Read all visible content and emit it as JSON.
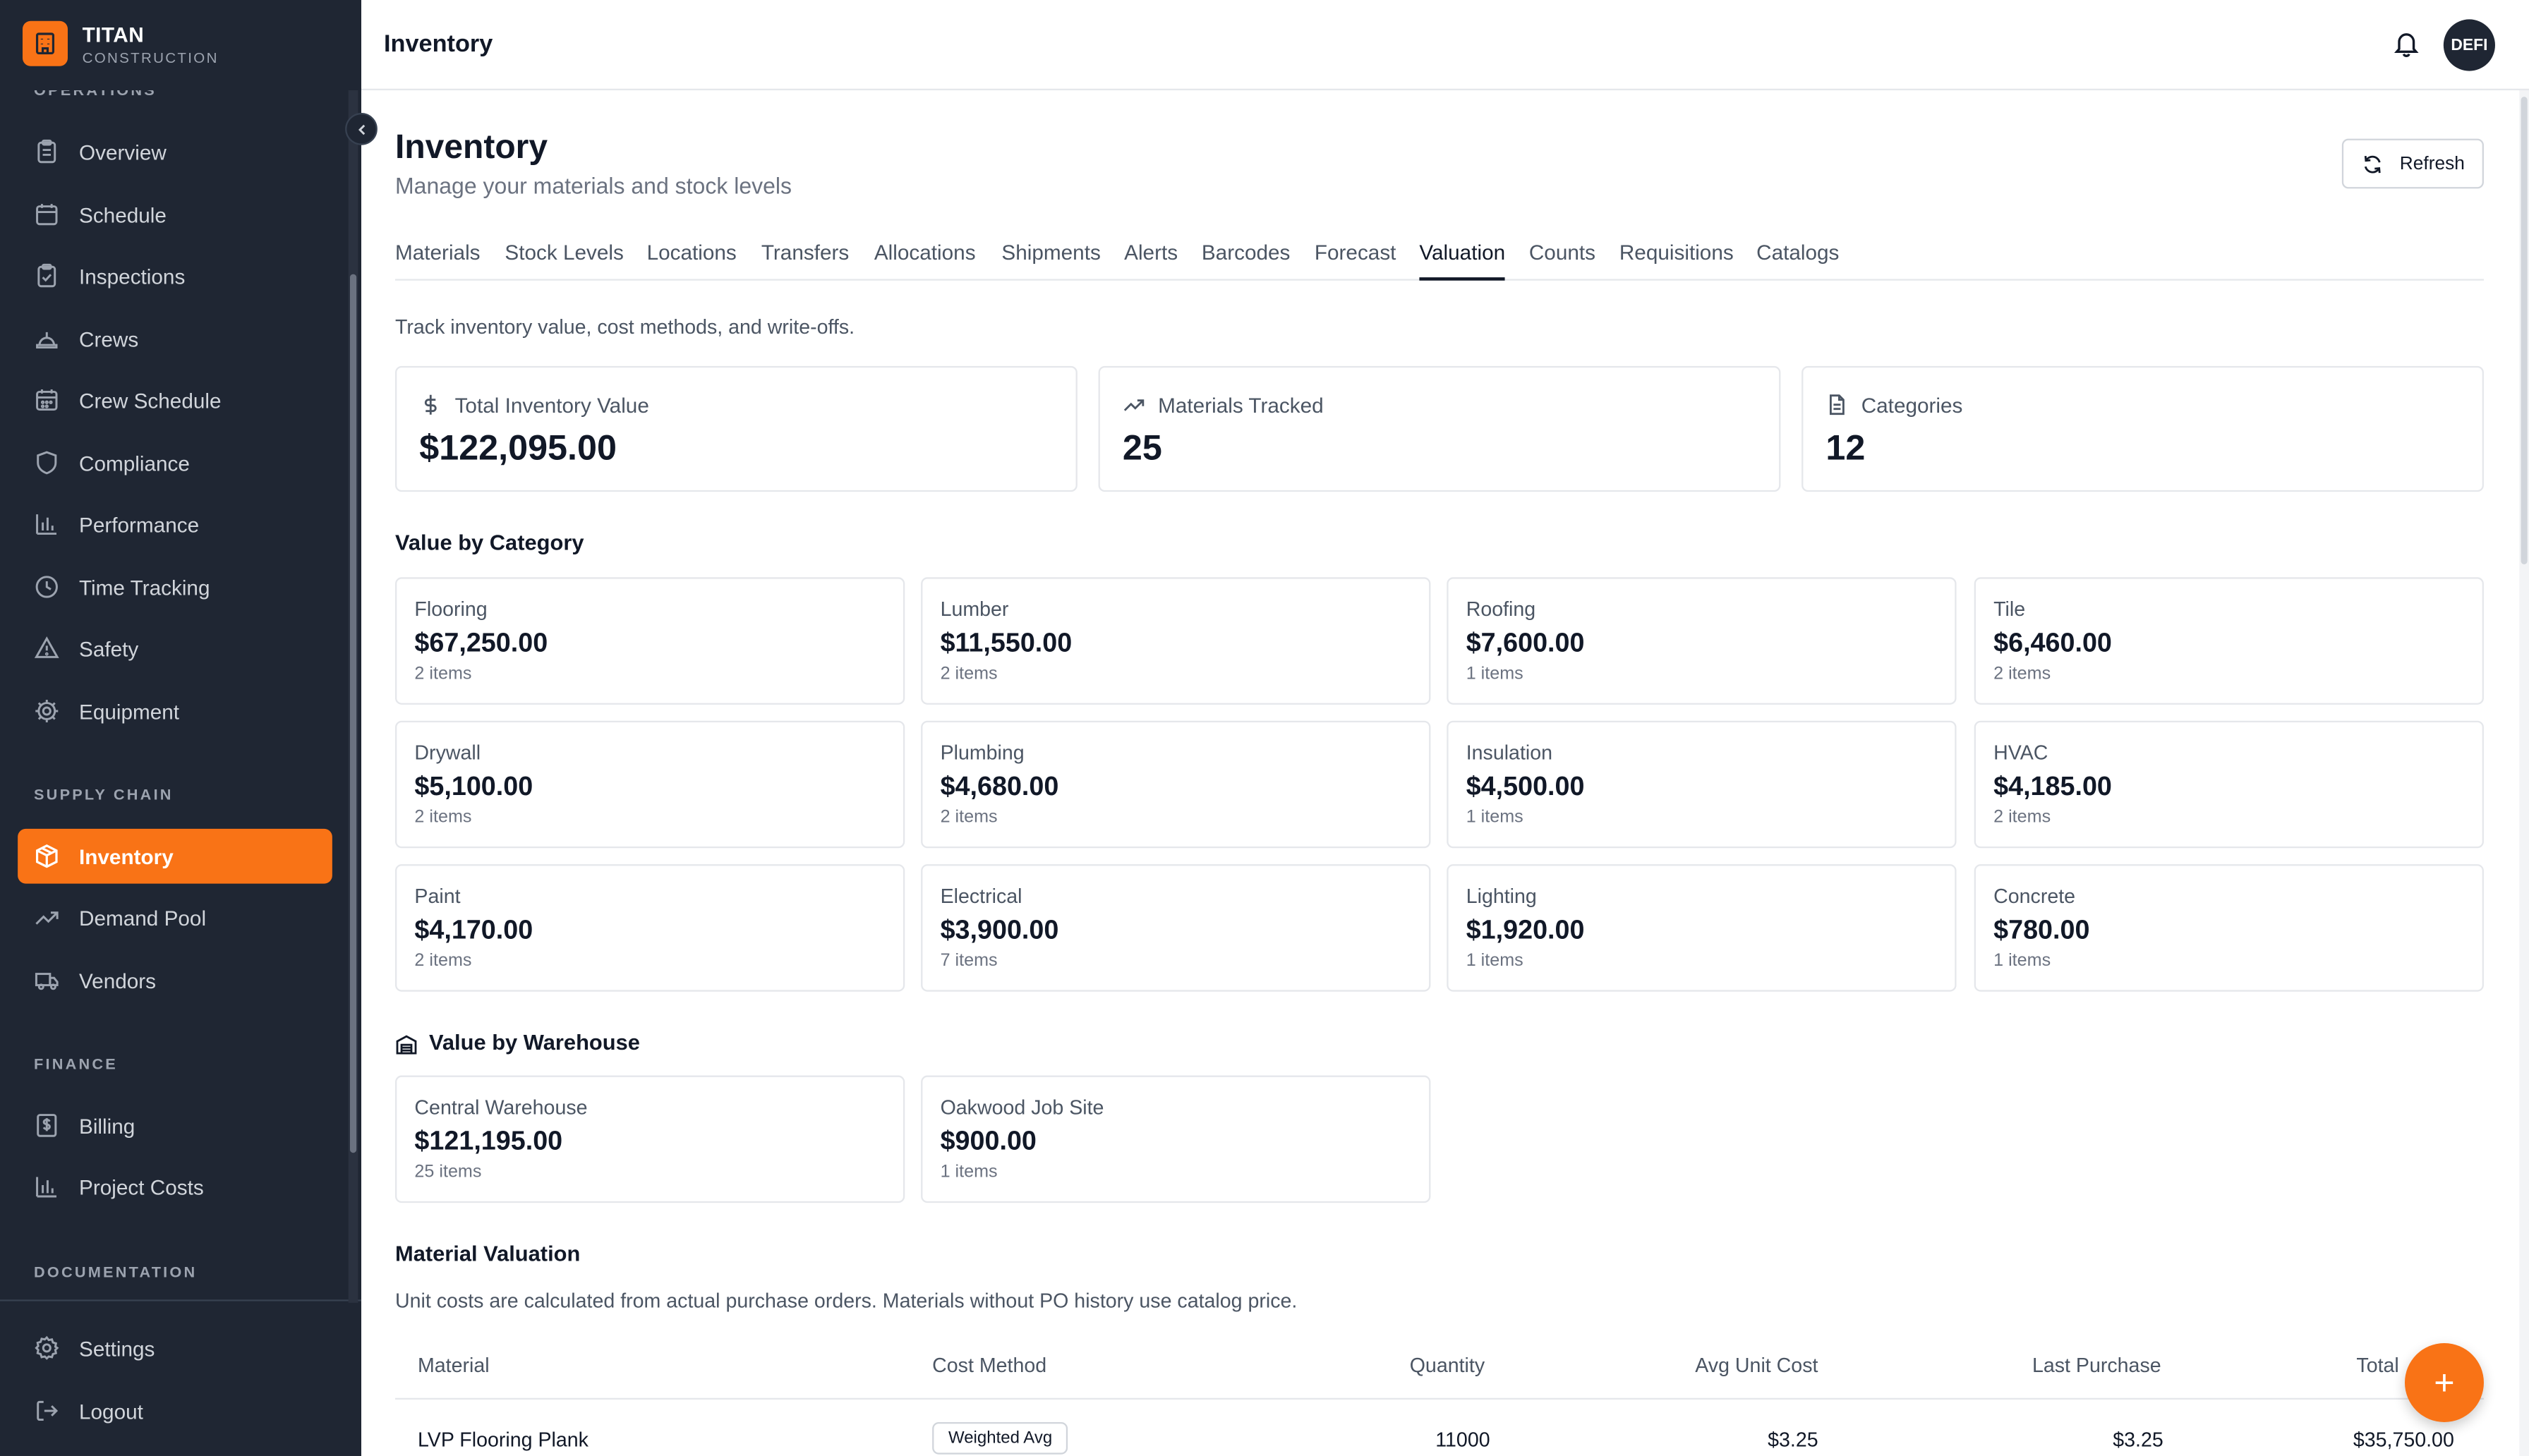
{
  "brand": {
    "name": "TITAN",
    "sub": "CONSTRUCTION"
  },
  "sidebar": {
    "sections": {
      "operations": "OPERATIONS",
      "supply_chain": "SUPPLY CHAIN",
      "finance": "FINANCE",
      "documentation": "DOCUMENTATION"
    },
    "items": {
      "overview": "Overview",
      "schedule": "Schedule",
      "inspections": "Inspections",
      "crews": "Crews",
      "crew_schedule": "Crew Schedule",
      "compliance": "Compliance",
      "performance": "Performance",
      "time_tracking": "Time Tracking",
      "safety": "Safety",
      "equipment": "Equipment",
      "inventory": "Inventory",
      "demand_pool": "Demand Pool",
      "vendors": "Vendors",
      "billing": "Billing",
      "project_costs": "Project Costs",
      "settings": "Settings",
      "logout": "Logout"
    },
    "active": "inventory"
  },
  "header": {
    "title": "Inventory",
    "avatar_text": "DEFI"
  },
  "page": {
    "title": "Inventory",
    "subtitle": "Manage your materials and stock levels",
    "refresh_label": "Refresh",
    "tabs": [
      "Materials",
      "Stock Levels",
      "Locations",
      "Transfers",
      "Allocations",
      "Shipments",
      "Alerts",
      "Barcodes",
      "Forecast",
      "Valuation",
      "Counts",
      "Requisitions",
      "Catalogs"
    ],
    "active_tab": "Valuation",
    "description": "Track inventory value, cost methods, and write-offs."
  },
  "stats": [
    {
      "label": "Total Inventory Value",
      "value": "$122,095.00",
      "icon": "dollar-icon"
    },
    {
      "label": "Materials Tracked",
      "value": "25",
      "icon": "trending-up-icon"
    },
    {
      "label": "Categories",
      "value": "12",
      "icon": "document-icon"
    }
  ],
  "value_by_category": {
    "title": "Value by Category",
    "items": [
      {
        "name": "Flooring",
        "amount": "$67,250.00",
        "count": "2 items"
      },
      {
        "name": "Lumber",
        "amount": "$11,550.00",
        "count": "2 items"
      },
      {
        "name": "Roofing",
        "amount": "$7,600.00",
        "count": "1 items"
      },
      {
        "name": "Tile",
        "amount": "$6,460.00",
        "count": "2 items"
      },
      {
        "name": "Drywall",
        "amount": "$5,100.00",
        "count": "2 items"
      },
      {
        "name": "Plumbing",
        "amount": "$4,680.00",
        "count": "2 items"
      },
      {
        "name": "Insulation",
        "amount": "$4,500.00",
        "count": "1 items"
      },
      {
        "name": "HVAC",
        "amount": "$4,185.00",
        "count": "2 items"
      },
      {
        "name": "Paint",
        "amount": "$4,170.00",
        "count": "2 items"
      },
      {
        "name": "Electrical",
        "amount": "$3,900.00",
        "count": "7 items"
      },
      {
        "name": "Lighting",
        "amount": "$1,920.00",
        "count": "1 items"
      },
      {
        "name": "Concrete",
        "amount": "$780.00",
        "count": "1 items"
      }
    ]
  },
  "value_by_warehouse": {
    "title": "Value by Warehouse",
    "items": [
      {
        "name": "Central Warehouse",
        "amount": "$121,195.00",
        "count": "25 items"
      },
      {
        "name": "Oakwood Job Site",
        "amount": "$900.00",
        "count": "1 items"
      }
    ]
  },
  "material_valuation": {
    "title": "Material Valuation",
    "note": "Unit costs are calculated from actual purchase orders. Materials without PO history use catalog price.",
    "columns": [
      "Material",
      "Cost Method",
      "Quantity",
      "Avg Unit Cost",
      "Last Purchase",
      "Total"
    ],
    "rows": [
      {
        "material": "LVP Flooring Plank",
        "cost_method": "Weighted Avg",
        "quantity": "11000",
        "avg_unit_cost": "$3.25",
        "last_purchase": "$3.25",
        "total": "$35,750.00"
      }
    ]
  },
  "fab_label": "+"
}
